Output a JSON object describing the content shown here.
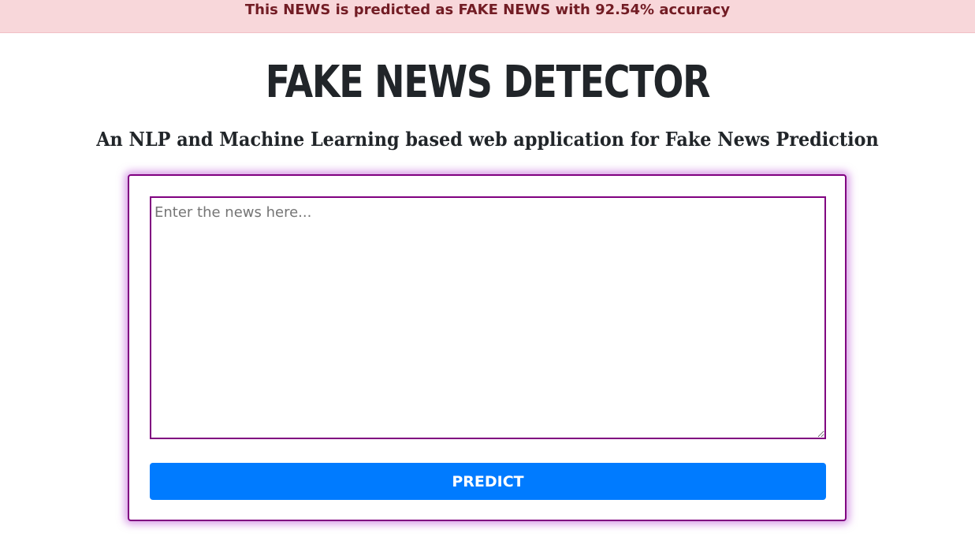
{
  "alert": {
    "message": "This NEWS is predicted as FAKE NEWS with 92.54% accuracy"
  },
  "header": {
    "title": "FAKE NEWS DETECTOR",
    "subtitle": "An NLP and Machine Learning based web application for Fake News Prediction"
  },
  "form": {
    "news_placeholder": "Enter the news here...",
    "news_value": "",
    "predict_label": "PREDICT"
  },
  "colors": {
    "alert_bg": "#f8d7da",
    "alert_text": "#721c24",
    "accent_border": "#800080",
    "button_bg": "#007bff"
  }
}
